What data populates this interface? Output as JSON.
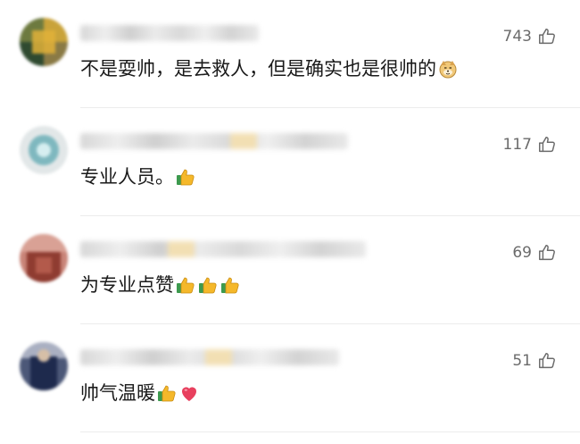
{
  "comments": [
    {
      "likes": "743",
      "text": "不是耍帅，是去救人，但是确实也是很帅的",
      "emojis": [
        "doge-face-icon"
      ]
    },
    {
      "likes": "117",
      "text": "专业人员。",
      "emojis": [
        "thumbs-up-icon"
      ]
    },
    {
      "likes": "69",
      "text": "为专业点赞",
      "emojis": [
        "thumbs-up-icon",
        "thumbs-up-icon",
        "thumbs-up-icon"
      ]
    },
    {
      "likes": "51",
      "text": "帅气温暖",
      "emojis": [
        "thumbs-up-icon",
        "heart-icon"
      ]
    }
  ],
  "icons": {
    "like": "like-thumb-icon"
  },
  "colors": {
    "like_text": "#6b6b6b",
    "heart": "#e8405e",
    "thumb": "#f5b82a",
    "divider": "#ececec"
  }
}
